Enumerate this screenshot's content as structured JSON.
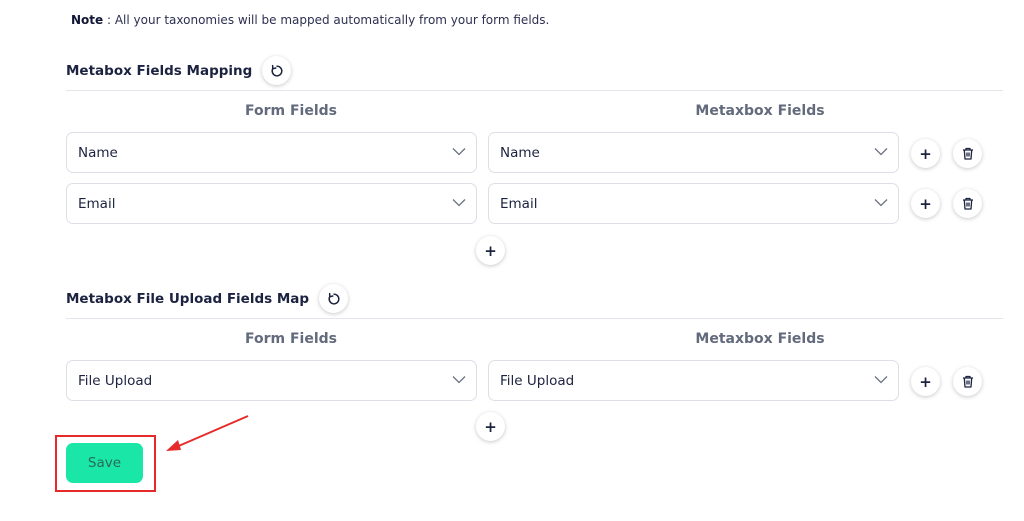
{
  "note": {
    "label": "Note",
    "text": " : All your taxonomies will be mapped automatically from your form fields."
  },
  "sections": [
    {
      "title": "Metabox Fields Mapping",
      "col_form": "Form Fields",
      "col_meta": "Metaxbox Fields",
      "rows": [
        {
          "form_value": "Name",
          "meta_value": "Name"
        },
        {
          "form_value": "Email",
          "meta_value": "Email"
        }
      ]
    },
    {
      "title": "Metabox File Upload Fields Map",
      "col_form": "Form Fields",
      "col_meta": "Metaxbox Fields",
      "rows": [
        {
          "form_value": "File Upload",
          "meta_value": "File Upload"
        }
      ]
    }
  ],
  "buttons": {
    "add": "+",
    "save": "Save"
  },
  "icons": {
    "refresh": "refresh-icon",
    "chevron": "chevron-down-icon",
    "trash": "trash-icon",
    "arrow": "arrow-annotation"
  },
  "colors": {
    "save_bg": "#1ae6a8",
    "highlight": "#e62a2a",
    "text": "#1c2340"
  }
}
